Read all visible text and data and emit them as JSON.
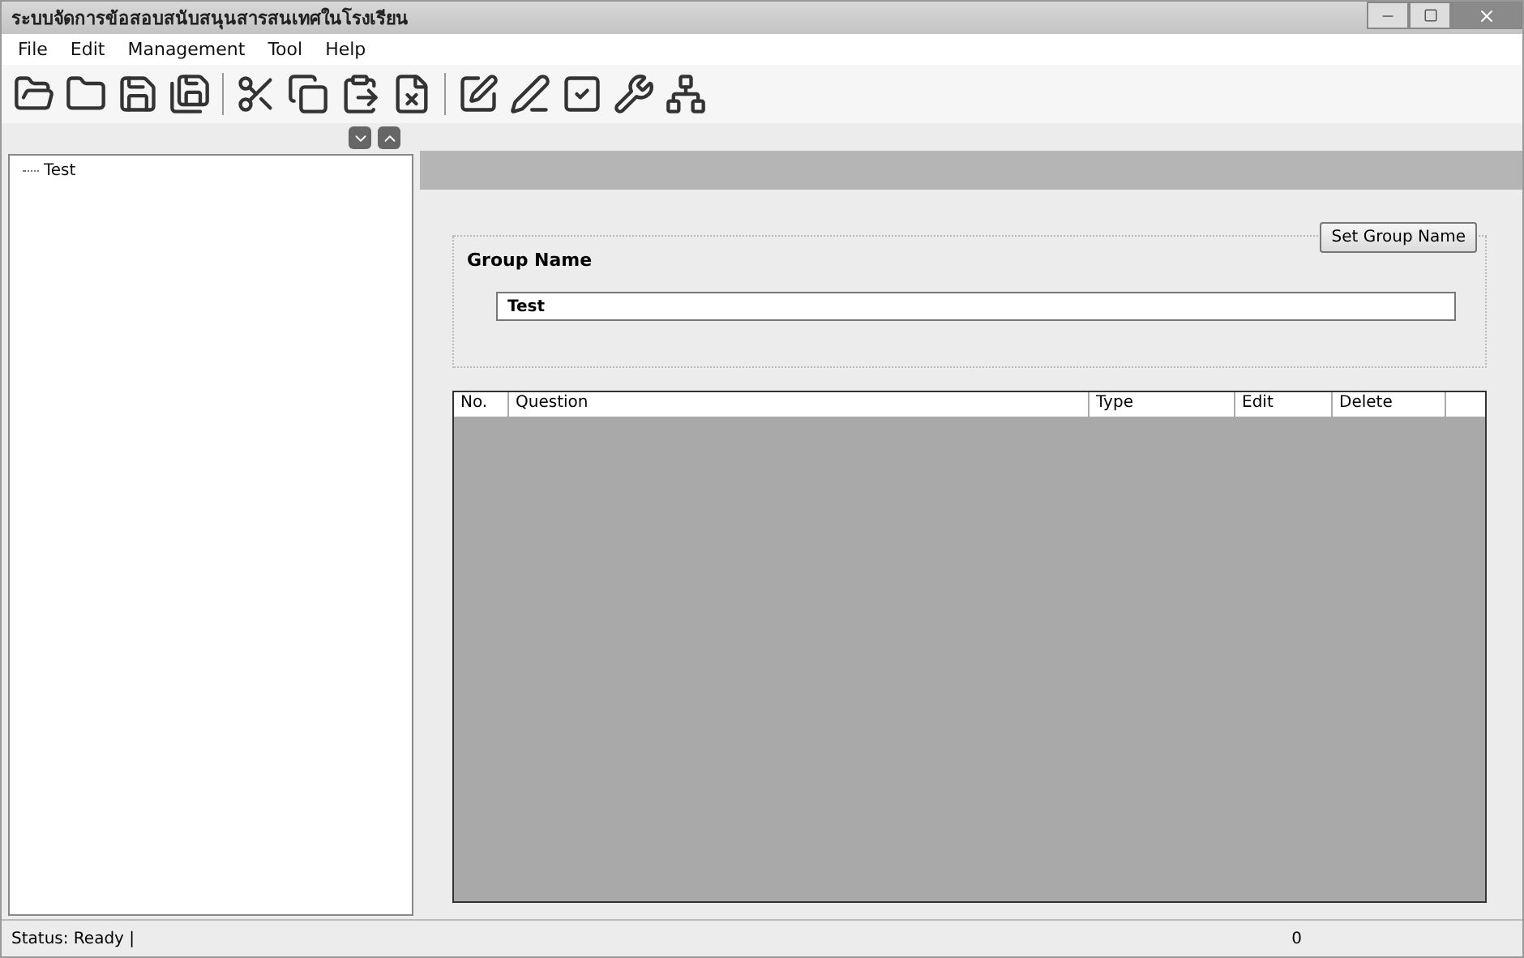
{
  "window": {
    "title": "ระบบจัดการข้อสอบสนับสนุนสารสนเทศในโรงเรียน"
  },
  "menu": [
    "File",
    "Edit",
    "Management",
    "Tool",
    "Help"
  ],
  "toolbar": [
    {
      "kind": "open"
    },
    {
      "kind": "folder"
    },
    {
      "kind": "save"
    },
    {
      "kind": "save-all"
    },
    {
      "kind": "separator"
    },
    {
      "kind": "cut"
    },
    {
      "kind": "copy"
    },
    {
      "kind": "paste"
    },
    {
      "kind": "delete"
    },
    {
      "kind": "separator"
    },
    {
      "kind": "edit"
    },
    {
      "kind": "pen"
    },
    {
      "kind": "check"
    },
    {
      "kind": "tools"
    },
    {
      "kind": "tree"
    }
  ],
  "tree": {
    "items": [
      {
        "label": "Test",
        "selected": false
      }
    ]
  },
  "group": {
    "button": "Set Group Name",
    "legend": "Group Name",
    "value": "Test"
  },
  "table": {
    "columns": [
      "No.",
      "Question",
      "Type",
      "Edit",
      "Delete"
    ]
  },
  "status_bar": {
    "status": "Status:  Ready  |",
    "count": "0"
  }
}
